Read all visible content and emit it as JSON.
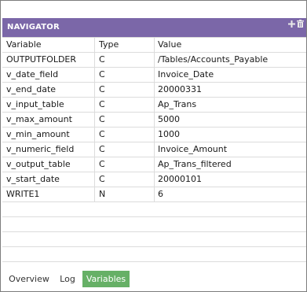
{
  "panel": {
    "title": "NAVIGATOR",
    "add_icon": "plus-icon",
    "delete_icon": "trash-icon",
    "title_bg": "#7b67a8"
  },
  "table": {
    "headers": {
      "variable": "Variable",
      "type": "Type",
      "value": "Value"
    },
    "rows": [
      {
        "variable": "OUTPUTFOLDER",
        "type": "C",
        "value": "/Tables/Accounts_Payable"
      },
      {
        "variable": "v_date_field",
        "type": "C",
        "value": "Invoice_Date"
      },
      {
        "variable": "v_end_date",
        "type": "C",
        "value": "20000331"
      },
      {
        "variable": "v_input_table",
        "type": "C",
        "value": "Ap_Trans"
      },
      {
        "variable": "v_max_amount",
        "type": "C",
        "value": "5000"
      },
      {
        "variable": "v_min_amount",
        "type": "C",
        "value": "1000"
      },
      {
        "variable": "v_numeric_field",
        "type": "C",
        "value": "Invoice_Amount"
      },
      {
        "variable": "v_output_table",
        "type": "C",
        "value": "Ap_Trans_filtered"
      },
      {
        "variable": "v_start_date",
        "type": "C",
        "value": "20000101"
      },
      {
        "variable": "WRITE1",
        "type": "N",
        "value": "6"
      }
    ]
  },
  "tabs": [
    {
      "label": "Overview",
      "active": false
    },
    {
      "label": "Log",
      "active": false
    },
    {
      "label": "Variables",
      "active": true
    }
  ],
  "colors": {
    "active_tab": "#66b066"
  }
}
